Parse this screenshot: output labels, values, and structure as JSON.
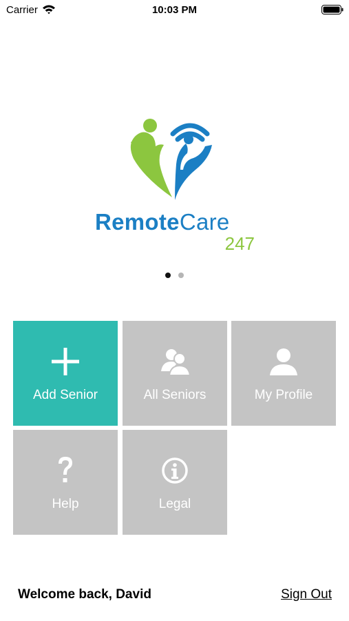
{
  "status_bar": {
    "carrier": "Carrier",
    "time": "10:03 PM"
  },
  "logo": {
    "name_part1": "Remote",
    "name_part2": "Care",
    "suffix": "247"
  },
  "pager": {
    "count": 2,
    "active_index": 0
  },
  "tiles": [
    {
      "label": "Add Senior",
      "icon": "plus-icon"
    },
    {
      "label": "All Seniors",
      "icon": "people-icon"
    },
    {
      "label": "My Profile",
      "icon": "person-icon"
    },
    {
      "label": "Help",
      "icon": "question-icon"
    },
    {
      "label": "Legal",
      "icon": "info-icon"
    }
  ],
  "footer": {
    "welcome": "Welcome back, David",
    "sign_out": "Sign Out"
  },
  "colors": {
    "primary_tile": "#2fbbb0",
    "tile": "#c4c4c4",
    "brand_blue": "#1b7fc4",
    "brand_green": "#8cc63f"
  }
}
